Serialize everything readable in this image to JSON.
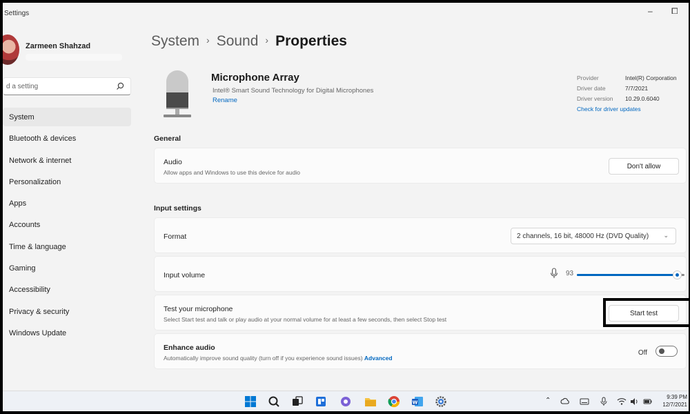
{
  "window": {
    "title": "Settings",
    "minimize_glyph": "–",
    "maximize_glyph": "⧠"
  },
  "user": {
    "name": "Zarmeen Shahzad"
  },
  "search": {
    "value": "d a setting"
  },
  "nav": {
    "items": [
      {
        "label": "System",
        "active": true
      },
      {
        "label": "Bluetooth & devices"
      },
      {
        "label": "Network & internet"
      },
      {
        "label": "Personalization"
      },
      {
        "label": "Apps"
      },
      {
        "label": "Accounts"
      },
      {
        "label": "Time & language"
      },
      {
        "label": "Gaming"
      },
      {
        "label": "Accessibility"
      },
      {
        "label": "Privacy & security"
      },
      {
        "label": "Windows Update"
      }
    ]
  },
  "breadcrumb": {
    "level1": "System",
    "level2": "Sound",
    "current": "Properties",
    "separator": "›"
  },
  "device": {
    "name": "Microphone Array",
    "description": "Intel® Smart Sound Technology for Digital Microphones",
    "rename": "Rename"
  },
  "driver": {
    "provider_label": "Provider",
    "provider_value": "Intel(R) Corporation",
    "date_label": "Driver date",
    "date_value": "7/7/2021",
    "version_label": "Driver version",
    "version_value": "10.29.0.6040",
    "check_link": "Check for driver updates"
  },
  "general": {
    "title": "General",
    "audio_title": "Audio",
    "audio_sub": "Allow apps and Windows to use this device for audio",
    "dont_allow_button": "Don't allow"
  },
  "input_settings": {
    "title": "Input settings",
    "format_label": "Format",
    "format_value": "2 channels, 16 bit, 48000 Hz (DVD Quality)",
    "volume_label": "Input volume",
    "volume_value": "93",
    "volume_level": 93,
    "test_title": "Test your microphone",
    "test_sub": "Select Start test and talk or play audio at your normal volume for at least a few seconds, then select Stop test",
    "start_test_button": "Start test",
    "enhance_title": "Enhance audio",
    "enhance_sub": "Automatically improve sound quality (turn off if you experience sound issues)",
    "enhance_link": "Advanced",
    "enhance_state": "Off"
  },
  "taskbar": {
    "time": "9:39 PM",
    "date": "12/7/2021"
  },
  "colors": {
    "accent": "#0067c0",
    "window_bg": "#f3f3f3",
    "card_bg": "#fbfbfb"
  }
}
